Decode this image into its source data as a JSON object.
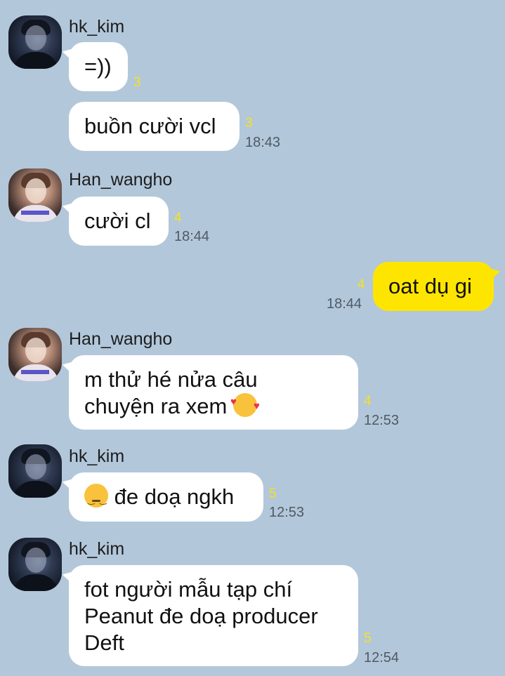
{
  "chat": {
    "m1": {
      "sender": "hk_kim",
      "text": "=))",
      "count": "3"
    },
    "m2": {
      "text": "buồn cười vcl",
      "count": "3",
      "time": "18:43"
    },
    "m3": {
      "sender": "Han_wangho",
      "text": "cười cl",
      "count": "4",
      "time": "18:44"
    },
    "m4": {
      "text": "oat dụ gi",
      "count": "4",
      "time": "18:44"
    },
    "m5": {
      "sender": "Han_wangho",
      "line1": "m thử hé nửa câu",
      "line2": "chuyện ra xem",
      "emoji": "smiling-face-with-hearts-emoji",
      "count": "4",
      "time": "12:53"
    },
    "m6": {
      "sender": "hk_kim",
      "emoji": "pensive-face-emoji",
      "text": "đe doạ ngkh",
      "count": "5",
      "time": "12:53"
    },
    "m7": {
      "sender": "hk_kim",
      "line1": "fot người mẫu tạp chí",
      "line2": "Peanut đe doạ producer",
      "line3": "Deft",
      "count": "5",
      "time": "12:54"
    }
  },
  "colors": {
    "background": "#b2c7da",
    "incoming_bubble": "#ffffff",
    "outgoing_bubble": "#fee500",
    "unread_count": "#f7e21e"
  }
}
